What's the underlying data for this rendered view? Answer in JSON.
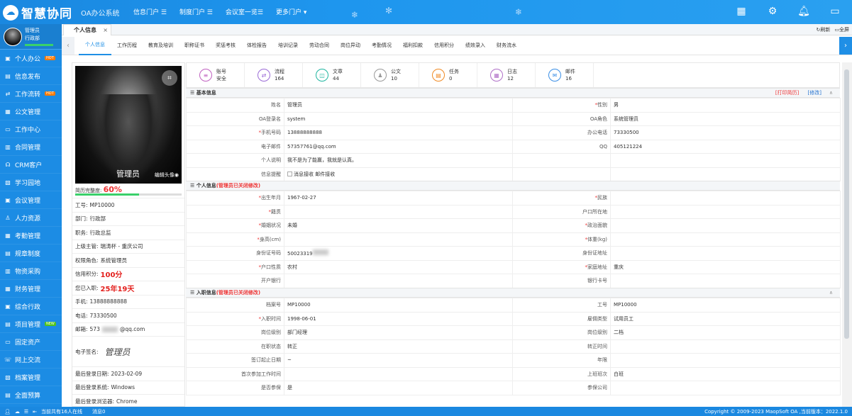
{
  "app": {
    "name": "智慧协同",
    "subtitle": "OA办公系统"
  },
  "topnav": [
    "信息门户 ☰",
    "制度门户 ☰",
    "会议室一览☰",
    "更多门户 ▾"
  ],
  "user": {
    "name": "管理员",
    "role": "行政部"
  },
  "sidebar": [
    {
      "label": "个人办公",
      "badge": "HOT"
    },
    {
      "label": "信息发布",
      "badge": ""
    },
    {
      "label": "工作流转",
      "badge": "HOT"
    },
    {
      "label": "公文管理",
      "badge": ""
    },
    {
      "label": "工作中心",
      "badge": ""
    },
    {
      "label": "合同管理",
      "badge": ""
    },
    {
      "label": "CRM客户",
      "badge": ""
    },
    {
      "label": "学习园地",
      "badge": ""
    },
    {
      "label": "会议管理",
      "badge": ""
    },
    {
      "label": "人力资源",
      "badge": ""
    },
    {
      "label": "考勤管理",
      "badge": ""
    },
    {
      "label": "规章制度",
      "badge": ""
    },
    {
      "label": "物资采购",
      "badge": ""
    },
    {
      "label": "财务管理",
      "badge": ""
    },
    {
      "label": "综合行政",
      "badge": ""
    },
    {
      "label": "项目管理",
      "badge": "NEW"
    },
    {
      "label": "固定资产",
      "badge": ""
    },
    {
      "label": "网上交流",
      "badge": ""
    },
    {
      "label": "档案管理",
      "badge": ""
    },
    {
      "label": "全面预算",
      "badge": ""
    }
  ],
  "page_tab": "个人信息",
  "tools": {
    "refresh": "刷新",
    "fullscreen": "全屏"
  },
  "subtabs": [
    "个人信息",
    "工作历程",
    "教育及培训",
    "职称证书",
    "奖惩考核",
    "体检报告",
    "培训记录",
    "劳动合同",
    "岗位异动",
    "考勤情况",
    "福利扣款",
    "信用积分",
    "绩效录入",
    "财务流水"
  ],
  "profile": {
    "photo_name": "管理员",
    "photo_edit": "编辑头像",
    "completion_label": "简历完整度:",
    "completion": "60%",
    "completion_fraction": 0.6,
    "rows": [
      {
        "k": "工号:",
        "v": "MP10000"
      },
      {
        "k": "部门:",
        "v": "行政部"
      },
      {
        "k": "职务:",
        "v": "行政总监"
      },
      {
        "k": "上级主管:",
        "v": "瑞涛杯 - 重庆公司"
      },
      {
        "k": "权限角色:",
        "v": "系统管理员"
      },
      {
        "k": "信用积分:",
        "v": "100分",
        "red": true
      },
      {
        "k": "您已入职:",
        "v": "25年19天",
        "red": true
      },
      {
        "k": "手机:",
        "v": "13888888888"
      },
      {
        "k": "电话:",
        "v": "73330500"
      },
      {
        "k": "邮箱:",
        "v": "573",
        "tail": "@qq.com"
      }
    ],
    "signature_label": "电子签名:",
    "signature": "管理员",
    "last_login_date_label": "最后登录日期:",
    "last_login_date": "2023-02-09",
    "last_login_sys_label": "最后登录系统:",
    "last_login_sys": "Windows",
    "last_login_browser_label": "最后登录浏览器:",
    "last_login_browser": "Chrome"
  },
  "stats": [
    {
      "label": "账号",
      "value": "安全",
      "icon": "≡",
      "color": "#c060c0"
    },
    {
      "label": "流程",
      "value": "164",
      "icon": "⇄",
      "color": "#9b6bd6"
    },
    {
      "label": "文章",
      "value": "44",
      "icon": "◫",
      "color": "#1fb5a0"
    },
    {
      "label": "公文",
      "value": "10",
      "icon": "♟",
      "color": "#999999"
    },
    {
      "label": "任务",
      "value": "0",
      "icon": "▤",
      "color": "#f08a24"
    },
    {
      "label": "日志",
      "value": "12",
      "icon": "▦",
      "color": "#b070c8"
    },
    {
      "label": "邮件",
      "value": "16",
      "icon": "✉",
      "color": "#3a8ee6"
    }
  ],
  "basic": {
    "title": "基本信息",
    "print": "[打印简历]",
    "edit": "[修改]",
    "rows": [
      [
        "姓名",
        "管理员",
        "*性别",
        "男"
      ],
      [
        "OA登录名",
        "system",
        "OA角色",
        "系统管理员"
      ],
      [
        "*手机号码",
        "13888888888",
        "办公电话",
        "73330500"
      ],
      [
        "电子邮件",
        "57357761@qq.com",
        "QQ",
        "405121224"
      ],
      [
        "个人说明",
        "我不是为了能赢，我就是认真。",
        "",
        ""
      ],
      [
        "信息提醒",
        "消息接收  邮件接收",
        "",
        ""
      ]
    ]
  },
  "personal": {
    "title": "个人信息",
    "note": "(管理员已关闭修改)",
    "rows": [
      [
        "*出生年月",
        "1967-02-27",
        "*民族",
        ""
      ],
      [
        "*籍贯",
        "",
        "户口所在地",
        ""
      ],
      [
        "*婚姻状况",
        "未婚",
        "*政治面貌",
        ""
      ],
      [
        "*身高(cm)",
        "",
        "*体重(kg)",
        ""
      ],
      [
        "身份证号码",
        "50023319",
        "身份证地址",
        ""
      ],
      [
        "*户口性质",
        "农村",
        "*家庭地址",
        "重庆"
      ],
      [
        "开户银行",
        "",
        "银行卡号",
        ""
      ]
    ]
  },
  "employment": {
    "title": "入职信息",
    "note": "(管理员已关闭修改)",
    "rows": [
      [
        "档案号",
        "MP10000",
        "工号",
        "MP10000"
      ],
      [
        "*入职时间",
        "1998-06-01",
        "雇佣类型",
        "试用员工"
      ],
      [
        "岗位级别",
        "部门经理",
        "岗位级别",
        "二档"
      ],
      [
        "在职状态",
        "转正",
        "转正时间",
        ""
      ],
      [
        "签订起止日期",
        "~",
        "年限",
        ""
      ],
      [
        "首次参加工作时间",
        "",
        "上班班次",
        "白班"
      ],
      [
        "是否参保",
        "是",
        "参保公司",
        ""
      ]
    ]
  },
  "footer": {
    "online": "当前共有16人在线",
    "msg": "消息0",
    "copyright": "Copyright © 2009-2023 MaopSoft OA ,当前版本：2022.1.0"
  }
}
